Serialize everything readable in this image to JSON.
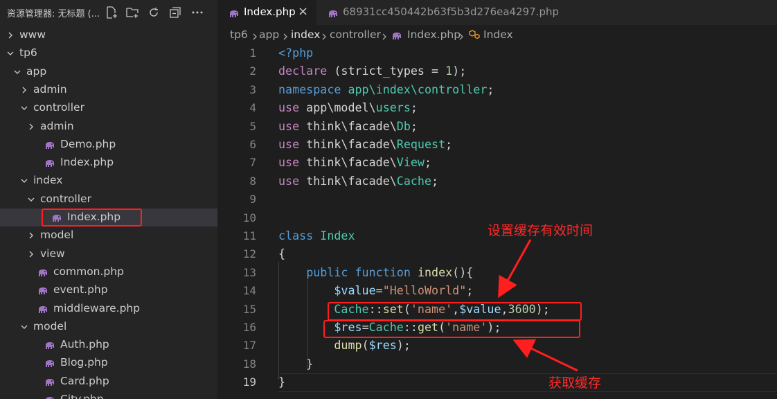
{
  "sidebar": {
    "title": "资源管理器: 无标题 (...",
    "header_icons": [
      "new-file-icon",
      "new-folder-icon",
      "refresh-icon",
      "collapse-all-icon",
      "more-icon"
    ],
    "items": [
      {
        "label": "www",
        "indent": 0,
        "kind": "folder",
        "expanded": false
      },
      {
        "label": "tp6",
        "indent": 0,
        "kind": "folder",
        "expanded": true
      },
      {
        "label": "app",
        "indent": 1,
        "kind": "folder",
        "expanded": true
      },
      {
        "label": "admin",
        "indent": 2,
        "kind": "folder",
        "expanded": false
      },
      {
        "label": "controller",
        "indent": 2,
        "kind": "folder",
        "expanded": true
      },
      {
        "label": "admin",
        "indent": 3,
        "kind": "folder",
        "expanded": false
      },
      {
        "label": "Demo.php",
        "indent": 3,
        "kind": "php"
      },
      {
        "label": "Index.php",
        "indent": 3,
        "kind": "php"
      },
      {
        "label": "index",
        "indent": 2,
        "kind": "folder",
        "expanded": true
      },
      {
        "label": "controller",
        "indent": 3,
        "kind": "folder",
        "expanded": true
      },
      {
        "label": "Index.php",
        "indent": 4,
        "kind": "php",
        "active": true
      },
      {
        "label": "model",
        "indent": 3,
        "kind": "folder",
        "expanded": false
      },
      {
        "label": "view",
        "indent": 3,
        "kind": "folder",
        "expanded": false
      },
      {
        "label": "common.php",
        "indent": 2,
        "kind": "php"
      },
      {
        "label": "event.php",
        "indent": 2,
        "kind": "php"
      },
      {
        "label": "middleware.php",
        "indent": 2,
        "kind": "php"
      },
      {
        "label": "model",
        "indent": 2,
        "kind": "folder",
        "expanded": true
      },
      {
        "label": "Auth.php",
        "indent": 3,
        "kind": "php"
      },
      {
        "label": "Blog.php",
        "indent": 3,
        "kind": "php"
      },
      {
        "label": "Card.php",
        "indent": 3,
        "kind": "php"
      },
      {
        "label": "City.php",
        "indent": 3,
        "kind": "php"
      }
    ]
  },
  "tabs": [
    {
      "label": "Index.php",
      "active": true,
      "close": "×"
    },
    {
      "label": "68931cc450442b63f5b3d276ea4297.php",
      "active": false
    }
  ],
  "breadcrumb": [
    "tp6",
    "app",
    "index",
    "controller",
    "Index.php",
    "Index"
  ],
  "editor": {
    "current_line": 19,
    "lines": [
      [
        [
          "kw",
          "<?php"
        ]
      ],
      [
        [
          "ctl",
          "declare"
        ],
        [
          "plain",
          " (strict_types = "
        ],
        [
          "num",
          "1"
        ],
        [
          "plain",
          ");"
        ]
      ],
      [
        [
          "kw",
          "namespace"
        ],
        [
          "plain",
          " "
        ],
        [
          "ty",
          "app\\index\\controller"
        ],
        [
          "plain",
          ";"
        ]
      ],
      [
        [
          "ctl",
          "use"
        ],
        [
          "plain",
          " app\\model\\"
        ],
        [
          "ty",
          "users"
        ],
        [
          "plain",
          ";"
        ]
      ],
      [
        [
          "ctl",
          "use"
        ],
        [
          "plain",
          " think\\facade\\"
        ],
        [
          "ty",
          "Db"
        ],
        [
          "plain",
          ";"
        ]
      ],
      [
        [
          "ctl",
          "use"
        ],
        [
          "plain",
          " think\\facade\\"
        ],
        [
          "ty",
          "Request"
        ],
        [
          "plain",
          ";"
        ]
      ],
      [
        [
          "ctl",
          "use"
        ],
        [
          "plain",
          " think\\facade\\"
        ],
        [
          "ty",
          "View"
        ],
        [
          "plain",
          ";"
        ]
      ],
      [
        [
          "ctl",
          "use"
        ],
        [
          "plain",
          " think\\facade\\"
        ],
        [
          "ty",
          "Cache"
        ],
        [
          "plain",
          ";"
        ]
      ],
      [],
      [],
      [
        [
          "kw",
          "class"
        ],
        [
          "plain",
          " "
        ],
        [
          "ty",
          "Index"
        ]
      ],
      [
        [
          "plain",
          "{"
        ]
      ],
      [
        [
          "plain",
          "    "
        ],
        [
          "kw",
          "public"
        ],
        [
          "plain",
          " "
        ],
        [
          "kw",
          "function"
        ],
        [
          "plain",
          " "
        ],
        [
          "fn",
          "index"
        ],
        [
          "plain",
          "(){"
        ]
      ],
      [
        [
          "plain",
          "        "
        ],
        [
          "var",
          "$value"
        ],
        [
          "plain",
          "="
        ],
        [
          "str",
          "\"HelloWorld\""
        ],
        [
          "plain",
          ";"
        ]
      ],
      [
        [
          "plain",
          "        "
        ],
        [
          "ty",
          "Cache"
        ],
        [
          "plain",
          "::"
        ],
        [
          "fn",
          "set"
        ],
        [
          "plain",
          "("
        ],
        [
          "str",
          "'name'"
        ],
        [
          "plain",
          ","
        ],
        [
          "var",
          "$value"
        ],
        [
          "plain",
          ","
        ],
        [
          "num",
          "3600"
        ],
        [
          "plain",
          ");"
        ]
      ],
      [
        [
          "plain",
          "        "
        ],
        [
          "var",
          "$res"
        ],
        [
          "plain",
          "="
        ],
        [
          "ty",
          "Cache"
        ],
        [
          "plain",
          "::"
        ],
        [
          "fn",
          "get"
        ],
        [
          "plain",
          "("
        ],
        [
          "str",
          "'name'"
        ],
        [
          "plain",
          ");"
        ]
      ],
      [
        [
          "plain",
          "        "
        ],
        [
          "fn",
          "dump"
        ],
        [
          "plain",
          "("
        ],
        [
          "var",
          "$res"
        ],
        [
          "plain",
          ");"
        ]
      ],
      [
        [
          "plain",
          "    }"
        ]
      ],
      [
        [
          "plain",
          "}"
        ]
      ]
    ]
  },
  "annotations": {
    "label_set": "设置缓存有效时间",
    "label_get": "获取缓存",
    "color": "#ff1f1f"
  },
  "colors": {
    "background": "#1e1e1e",
    "sidebar": "#252526",
    "php_icon": "#a074c4"
  }
}
